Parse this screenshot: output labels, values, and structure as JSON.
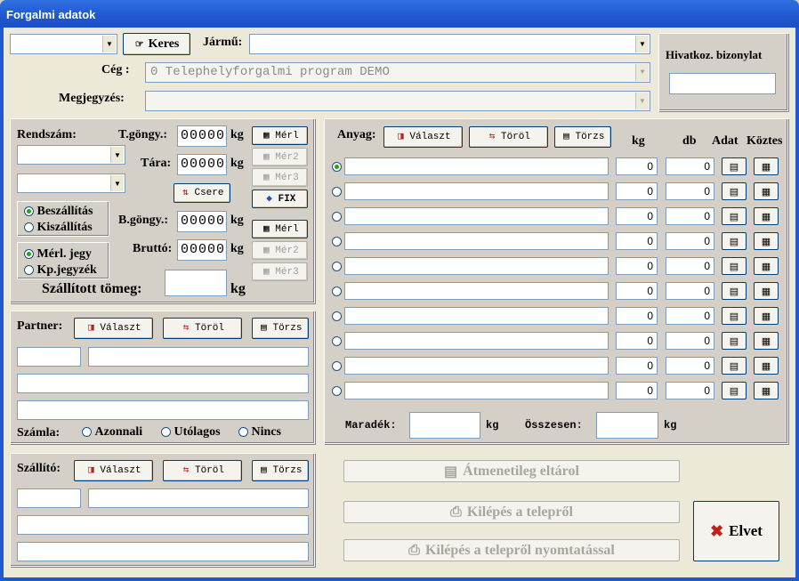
{
  "window": {
    "title": "Forgalmi adatok"
  },
  "top": {
    "search_button": "Keres",
    "jarmu_label": "Jármű:",
    "ceg_label": "Cég :",
    "ceg_value": "0 Telephelyforgalmi program DEMO",
    "megjegyzes_label": "Megjegyzés:",
    "hivatkoz_label": "Hivatkoz. bizonylat"
  },
  "weigh": {
    "rendszam_label": "Rendszám:",
    "tgongy_label": "T.göngy.:",
    "tara_label": "Tára:",
    "bgongy_label": "B.göngy.:",
    "brutto_label": "Bruttó:",
    "tgongy_value": "00000",
    "tara_value": "00000",
    "bgongy_value": "00000",
    "brutto_value": "00000",
    "unit": "kg",
    "mer1": "Mérl",
    "mer2": "Mér2",
    "mer3": "Mér3",
    "csere": "Csere",
    "fix": "FIX",
    "beszallitas": "Beszállítás",
    "kiszallitas": "Kiszállítás",
    "merl_jegy": "Mérl. jegy",
    "kp_jegyzek": "Kp.jegyzék",
    "szallitott_label": "Szállított tömeg:"
  },
  "partner": {
    "label": "Partner:",
    "valaszt": "Választ",
    "torol": "Töröl",
    "torzs": "Törzs",
    "szamla_label": "Számla:",
    "opt1": "Azonnali",
    "opt2": "Utólagos",
    "opt3": "Nincs"
  },
  "szallito": {
    "label": "Szállító:",
    "valaszt": "Választ",
    "torol": "Töröl",
    "torzs": "Törzs"
  },
  "anyag": {
    "label": "Anyag:",
    "valaszt": "Választ",
    "torol": "Töröl",
    "torzs": "Törzs",
    "col_kg": "kg",
    "col_db": "db",
    "col_adat": "Adat",
    "col_koztes": "Köztes",
    "rows": [
      {
        "kg": "0",
        "db": "0"
      },
      {
        "kg": "0",
        "db": "0"
      },
      {
        "kg": "0",
        "db": "0"
      },
      {
        "kg": "0",
        "db": "0"
      },
      {
        "kg": "0",
        "db": "0"
      },
      {
        "kg": "0",
        "db": "0"
      },
      {
        "kg": "0",
        "db": "0"
      },
      {
        "kg": "0",
        "db": "0"
      },
      {
        "kg": "0",
        "db": "0"
      },
      {
        "kg": "0",
        "db": "0"
      }
    ],
    "maradek_label": "Maradék:",
    "osszesen_label": "Összesen:",
    "unit": "kg"
  },
  "actions": {
    "atmenetileg": "Átmenetileg eltárol",
    "kilepes": "Kilépés a telepről",
    "kilepes_nyomtatas": "Kilépés a telepről nyomtatással",
    "elvet": "Elvet"
  },
  "colors": {
    "titlebar": "#1f58d0",
    "panel": "#d4d0c8",
    "disabled_text": "#a7a69f",
    "elvet_icon": "#c0201a"
  }
}
